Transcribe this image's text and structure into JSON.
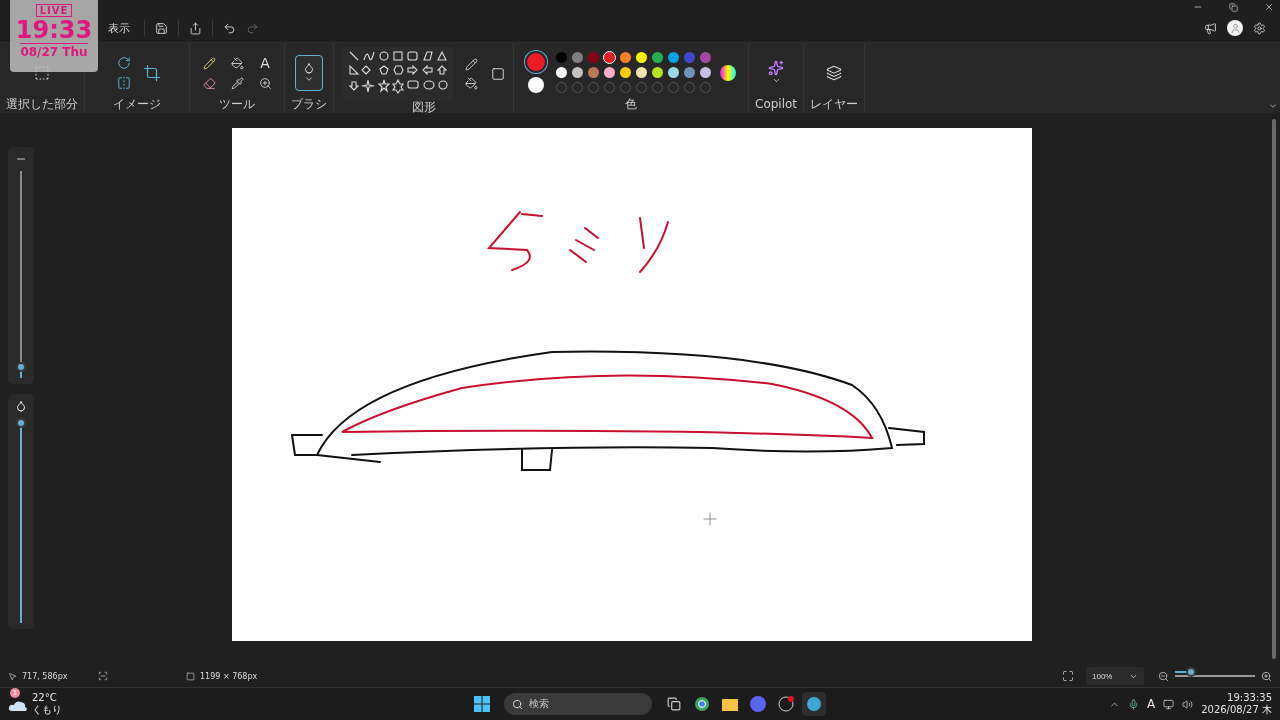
{
  "overlay": {
    "badge": "LIVE",
    "time": "19:33",
    "date": "08/27 Thu"
  },
  "menu": [
    {
      "label": "表示"
    }
  ],
  "ribbon": {
    "groups": [
      {
        "kind": "select",
        "label": "選択した部分"
      },
      {
        "kind": "image",
        "label": "イメージ"
      },
      {
        "kind": "tools",
        "label": "ツール",
        "tool_glyph": "A"
      },
      {
        "kind": "brush",
        "label": "ブラシ"
      },
      {
        "kind": "shapes",
        "label": "図形"
      },
      {
        "kind": "colors",
        "label": "色"
      },
      {
        "kind": "copilot",
        "label": "Copilot"
      },
      {
        "kind": "layers",
        "label": "レイヤー"
      }
    ],
    "current_colors": [
      {
        "color": "#ed1c24"
      },
      {
        "color": "#ffffff"
      }
    ],
    "palette": [
      {
        "color": "#000000",
        "selected": false
      },
      {
        "color": "#7f7f7f",
        "selected": false
      },
      {
        "color": "#880015",
        "selected": false
      },
      {
        "color": "#ed1c24",
        "selected": true
      },
      {
        "color": "#ff7f27",
        "selected": false
      },
      {
        "color": "#fff200",
        "selected": false
      },
      {
        "color": "#22b14c",
        "selected": false
      },
      {
        "color": "#00a2e8",
        "selected": false
      },
      {
        "color": "#3f48cc",
        "selected": false
      },
      {
        "color": "#a349a4",
        "selected": false
      },
      {
        "color": "#ffffff",
        "selected": false
      },
      {
        "color": "#c3c3c3",
        "selected": false
      },
      {
        "color": "#b97a57",
        "selected": false
      },
      {
        "color": "#ffaec9",
        "selected": false
      },
      {
        "color": "#ffc90e",
        "selected": false
      },
      {
        "color": "#efe4b0",
        "selected": false
      },
      {
        "color": "#b5e61d",
        "selected": false
      },
      {
        "color": "#99d9ea",
        "selected": false
      },
      {
        "color": "#7092be",
        "selected": false
      },
      {
        "color": "#c8bfe7",
        "selected": false
      }
    ]
  },
  "sliders": [
    {
      "kind": "size",
      "level": 0.03
    },
    {
      "kind": "opacity",
      "level": 1
    }
  ],
  "status_bar": {
    "cursor": "717, 586px",
    "canvas_size": "1199 × 768px",
    "zoom": "100%",
    "zoom_slider": {
      "level": 0.15
    }
  },
  "taskbar": {
    "weather": {
      "temp": "22°C",
      "condition": "くもり",
      "badge": "1"
    },
    "search": {
      "placeholder": "検索"
    },
    "ime": "A",
    "time": "19:33:35",
    "date": "2026/08/27 木"
  }
}
